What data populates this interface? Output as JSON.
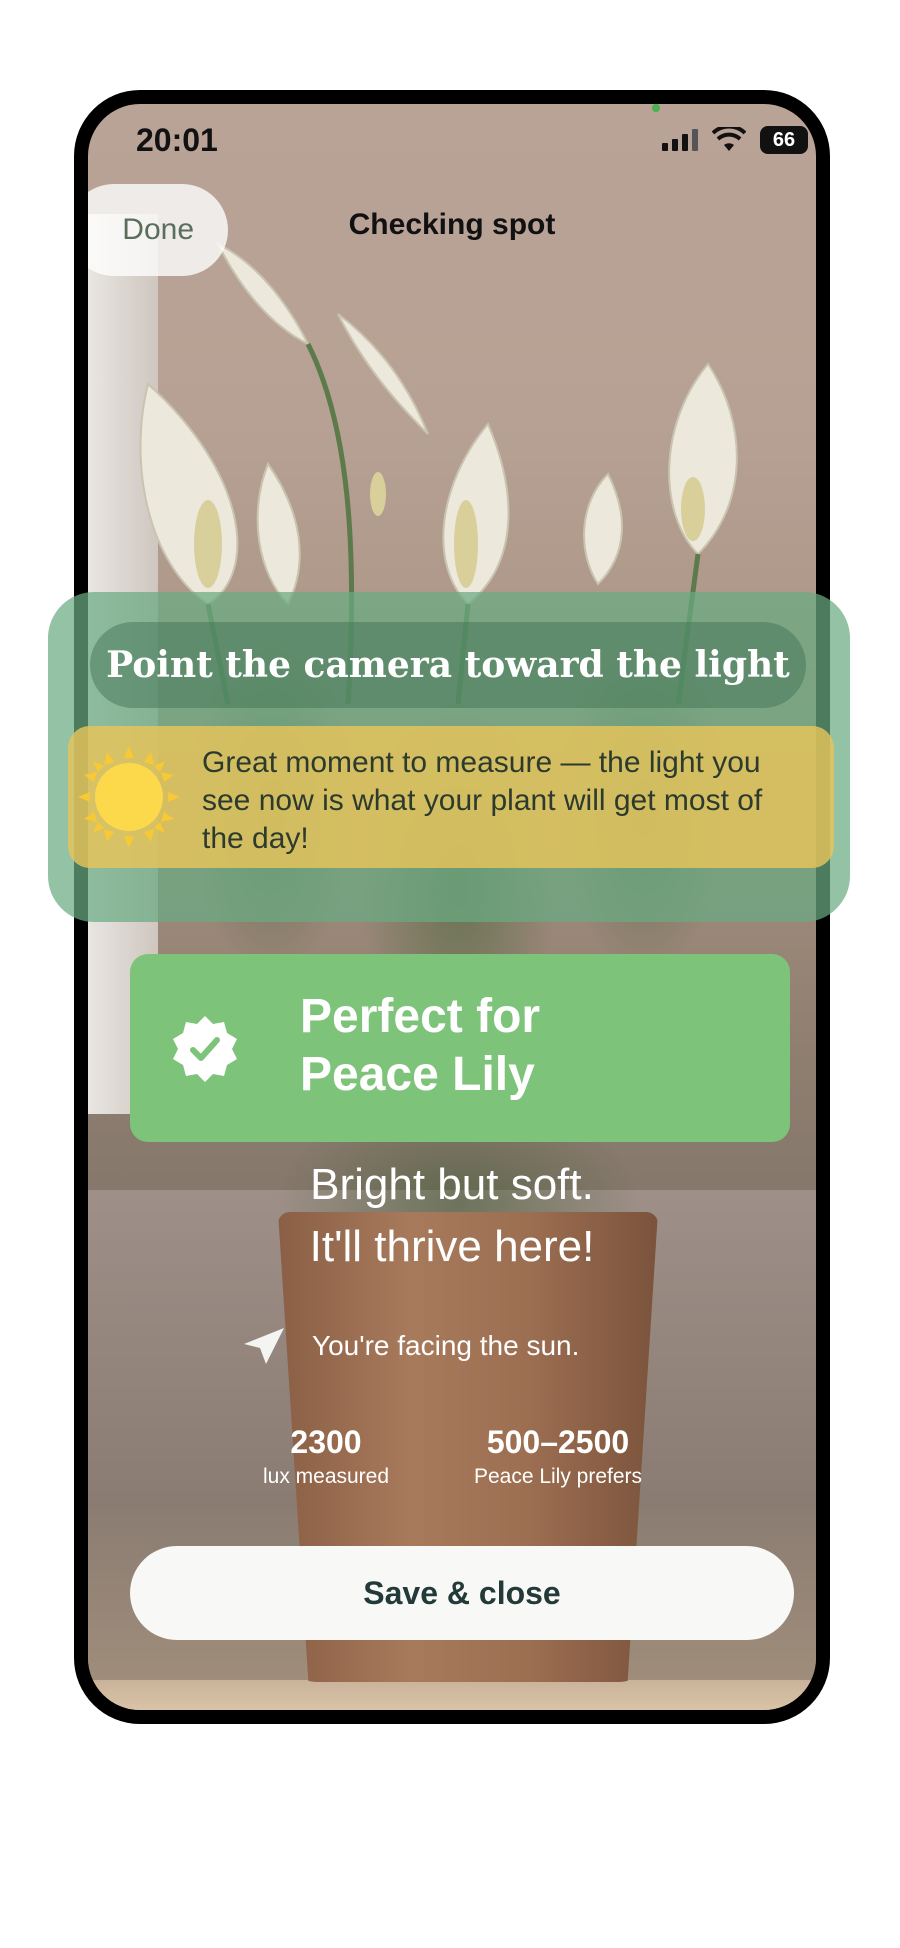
{
  "status_bar": {
    "time": "20:01",
    "battery": "66",
    "signal_icon": "cellular-signal-icon",
    "wifi_icon": "wifi-icon"
  },
  "nav": {
    "done_label": "Done",
    "title": "Checking spot"
  },
  "hint": {
    "title": "Point the camera toward the light",
    "tip_icon": "sun-icon",
    "tip_text": "Great moment to measure — the light you see now is  what your plant will get most of the day!"
  },
  "result": {
    "icon": "verified-badge-icon",
    "title_line1": "Perfect for",
    "title_line2": "Peace Lily",
    "verdict_line1": "Bright but soft.",
    "verdict_line2": "It'll thrive here!",
    "direction_icon": "navigation-arrow-icon",
    "direction_text": "You're facing the sun."
  },
  "stats": {
    "lux_value": "2300",
    "lux_label": "lux measured",
    "range_value": "500–2500",
    "range_label": "Peace Lily prefers"
  },
  "actions": {
    "save_label": "Save & close"
  },
  "colors": {
    "hint_panel": "#69AA82",
    "tip_box": "#E8C45A",
    "result_card": "#7EC37A",
    "save_text": "#223A38"
  }
}
